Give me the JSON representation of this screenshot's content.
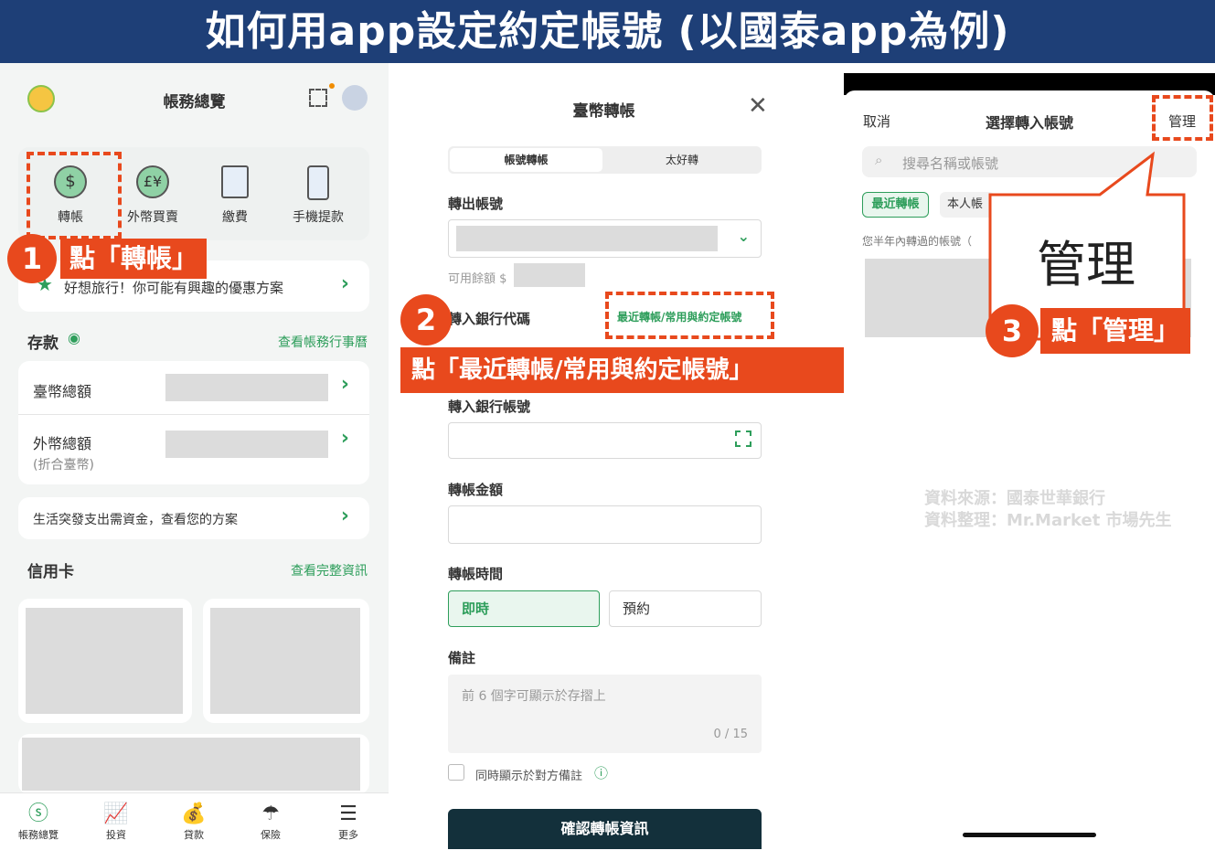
{
  "banner": {
    "title": "如何用app設定約定帳號 (以國泰app為例)"
  },
  "panel1": {
    "title": "帳務總覽",
    "actions": [
      "轉帳",
      "外幣買賣",
      "繳費",
      "手機提款"
    ],
    "promo": "好想旅行！你可能有興趣的優惠方案",
    "deposit": {
      "title": "存款",
      "link": "查看帳務行事曆",
      "twd": "臺幣總額",
      "fx": "外幣總額",
      "fx_note": "(折合臺幣)"
    },
    "life_banner": "生活突發支出需資金，查看您的方案",
    "credit": {
      "title": "信用卡",
      "link": "查看完整資訊"
    },
    "nav": [
      "帳務總覽",
      "投資",
      "貸款",
      "保險",
      "更多"
    ],
    "step": {
      "number": "1",
      "label": "點「轉帳」"
    }
  },
  "panel2": {
    "title": "臺幣轉帳",
    "tabs": [
      "帳號轉帳",
      "太好轉"
    ],
    "out_account": "轉出帳號",
    "available": "可用餘額 $",
    "bank_code": "轉入銀行代碼",
    "recent_link": "最近轉帳/常用與約定帳號",
    "in_account": "轉入銀行帳號",
    "amount": "轉帳金額",
    "time": "轉帳時間",
    "time_options": [
      "即時",
      "預約"
    ],
    "memo": "備註",
    "memo_placeholder": "前 6 個字可顯示於存摺上",
    "memo_count": "0 / 15",
    "show_memo": "同時顯示於對方備註",
    "confirm": "確認轉帳資訊",
    "step": {
      "number": "2",
      "label": "點「最近轉帳/常用與約定帳號」"
    }
  },
  "panel3": {
    "cancel": "取消",
    "title": "選擇轉入帳號",
    "manage": "管理",
    "search_placeholder": "搜尋名稱或帳號",
    "tabs": [
      "最近轉帳",
      "本人帳"
    ],
    "recent_note": "您半年內轉過的帳號（",
    "callout": "管理",
    "step": {
      "number": "3",
      "label": "點「管理」"
    },
    "source_line1": "資料來源：國泰世華銀行",
    "source_line2": "資料整理：Mr.Market 市場先生"
  },
  "colors": {
    "accent": "#e8491d",
    "brand_green": "#2e9e5b",
    "banner_bg": "#1e3f77"
  }
}
